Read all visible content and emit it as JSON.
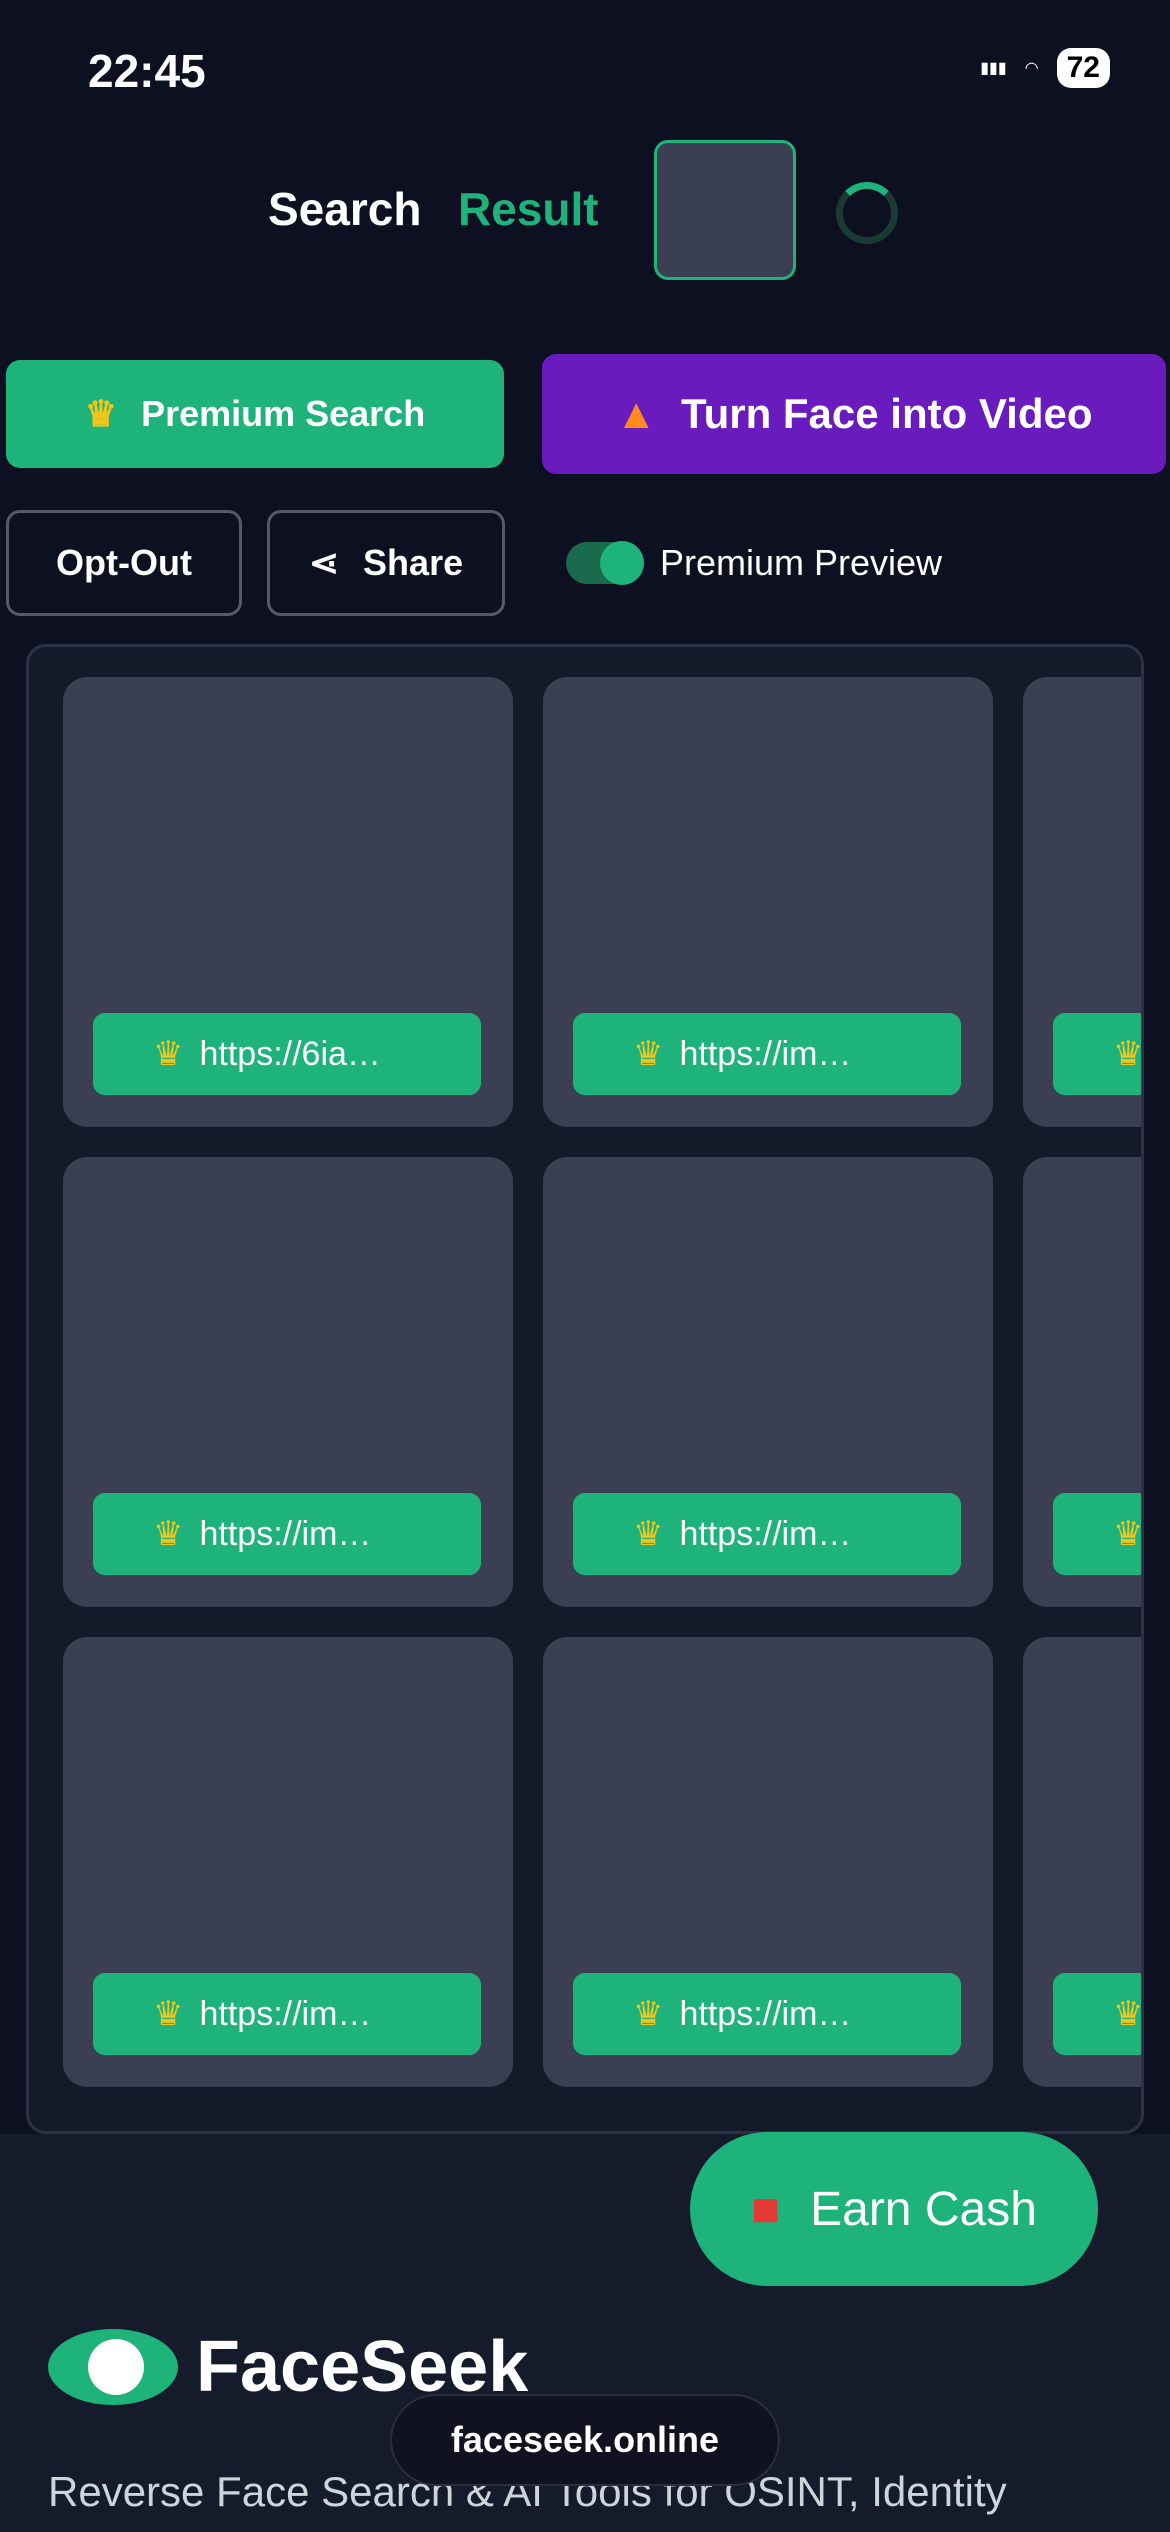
{
  "status": {
    "time": "22:45",
    "battery": "72"
  },
  "header": {
    "search": "Search",
    "result": "Result"
  },
  "buttons": {
    "premium": "Premium Search",
    "video": "Turn Face into Video",
    "optout": "Opt-Out",
    "share": "Share"
  },
  "toggle": {
    "label": "Premium Preview",
    "on": true
  },
  "results": [
    {
      "link": "https://6ia…"
    },
    {
      "link": "https://im…"
    },
    {
      "link": ""
    },
    {
      "link": "https://im…"
    },
    {
      "link": "https://im…"
    },
    {
      "link": ""
    },
    {
      "link": "https://im…"
    },
    {
      "link": "https://im…"
    },
    {
      "link": ""
    }
  ],
  "footer": {
    "earn": "Earn Cash",
    "brand": "FaceSeek",
    "url": "faceseek.online",
    "tagline": "Reverse Face Search & AI Tools for OSINT, Identity"
  },
  "colors": {
    "accent": "#1db37a",
    "video": "#6a1bbd",
    "bg": "#0d1020"
  }
}
